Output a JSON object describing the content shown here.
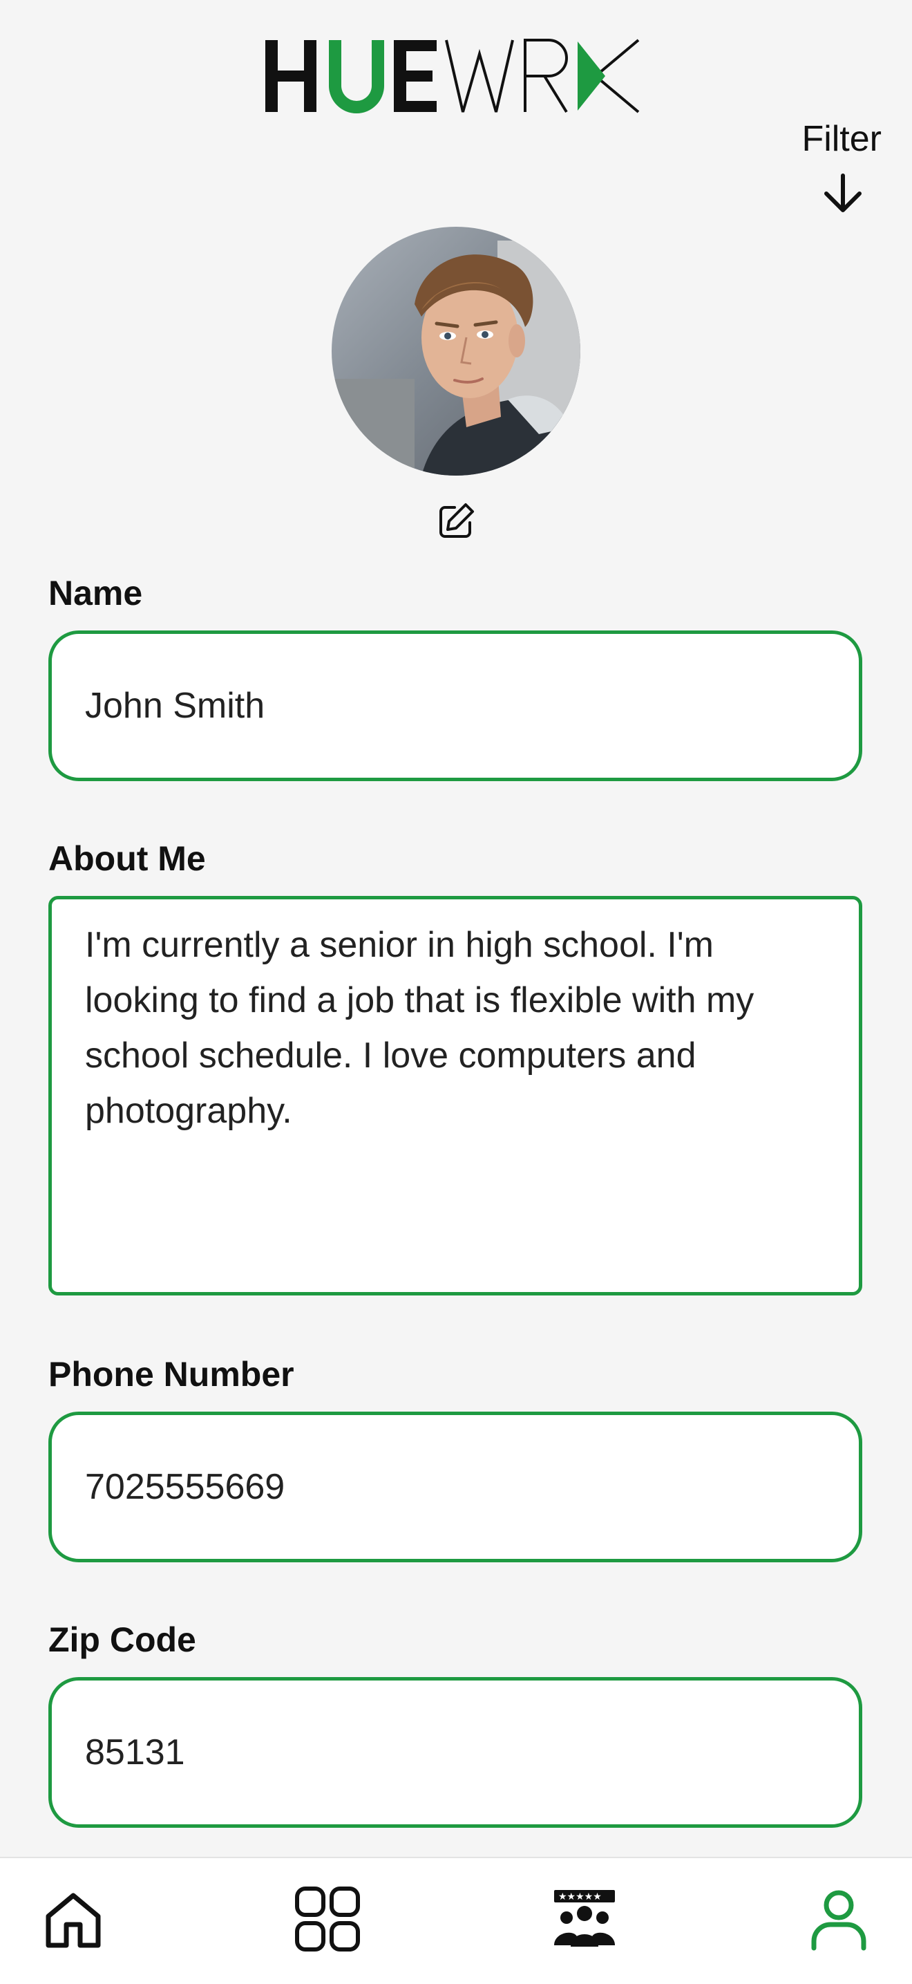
{
  "app": {
    "logo_text": "HUEWRX",
    "brand_color": "#1e9a41"
  },
  "header": {
    "filter_label": "Filter",
    "filter_icon": "arrow-down-icon"
  },
  "profile": {
    "avatar_icon": "avatar",
    "edit_icon": "edit-icon"
  },
  "form": {
    "name_label": "Name",
    "name_value": "John Smith",
    "about_label": "About Me",
    "about_value": "I'm currently a senior in high school. I'm looking to find a job that is flexible with my school schedule. I love computers and photography.",
    "phone_label": "Phone Number",
    "phone_value": "7025555669",
    "zip_label": "Zip Code",
    "zip_value": "85131"
  },
  "bottom_nav": {
    "items": [
      {
        "icon": "home-icon",
        "active": false
      },
      {
        "icon": "grid-icon",
        "active": false
      },
      {
        "icon": "reviews-group-icon",
        "active": false
      },
      {
        "icon": "profile-icon",
        "active": true
      }
    ]
  }
}
